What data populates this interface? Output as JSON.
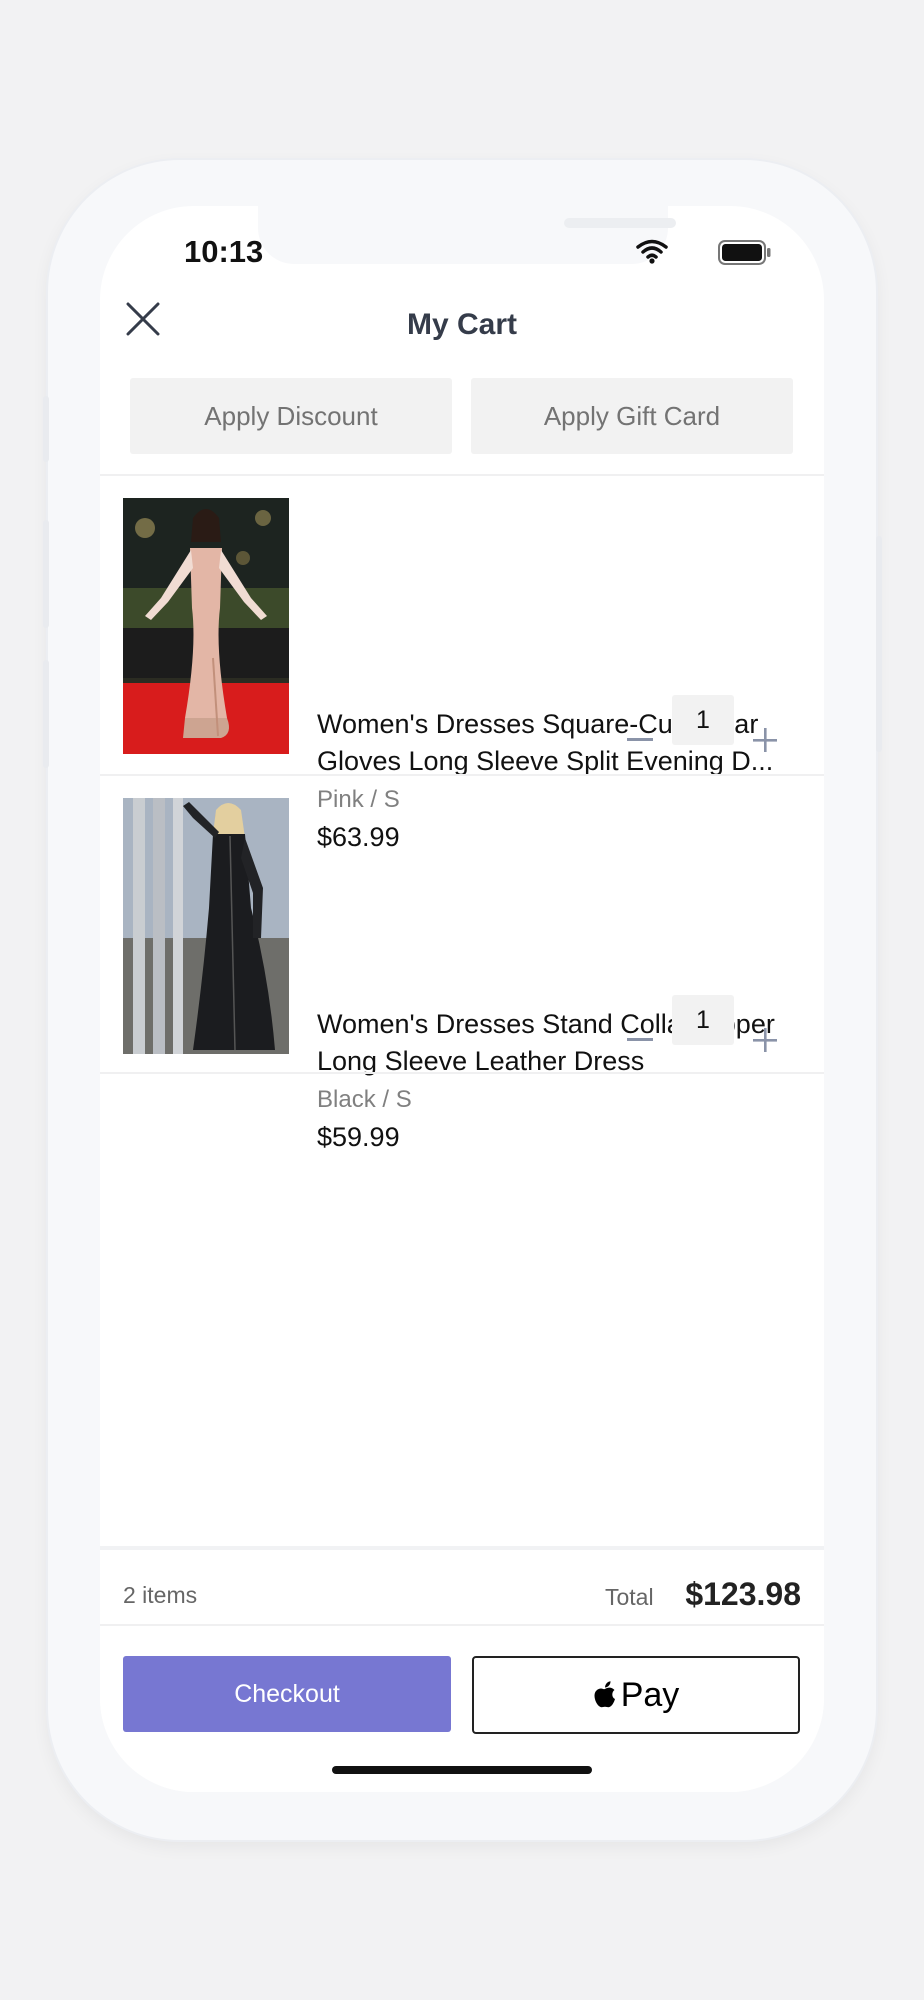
{
  "status_bar": {
    "time": "10:13"
  },
  "header": {
    "title": "My Cart"
  },
  "actions": {
    "discount_label": "Apply Discount",
    "gift_card_label": "Apply Gift Card"
  },
  "items": [
    {
      "title": "Women's Dresses Square-Cut Collar Gloves Long Sleeve Split Evening D...",
      "variant": "Pink / S",
      "price": "$63.99",
      "quantity": "1"
    },
    {
      "title": "Women's Dresses Stand Collar Zipper Long Sleeve Leather Dress",
      "variant": "Black / S",
      "price": "$59.99",
      "quantity": "1"
    }
  ],
  "summary": {
    "item_count": "2 items",
    "total_label": "Total",
    "total_amount": "$123.98"
  },
  "buttons": {
    "checkout_label": "Checkout",
    "apple_pay_label": "Pay"
  },
  "colors": {
    "accent": "#7777d2",
    "title": "#353c4a",
    "gray_button": "#f2f2f2"
  },
  "icons": [
    "close-icon",
    "wifi-icon",
    "battery-icon",
    "minus-icon",
    "plus-icon",
    "apple-logo-icon"
  ]
}
